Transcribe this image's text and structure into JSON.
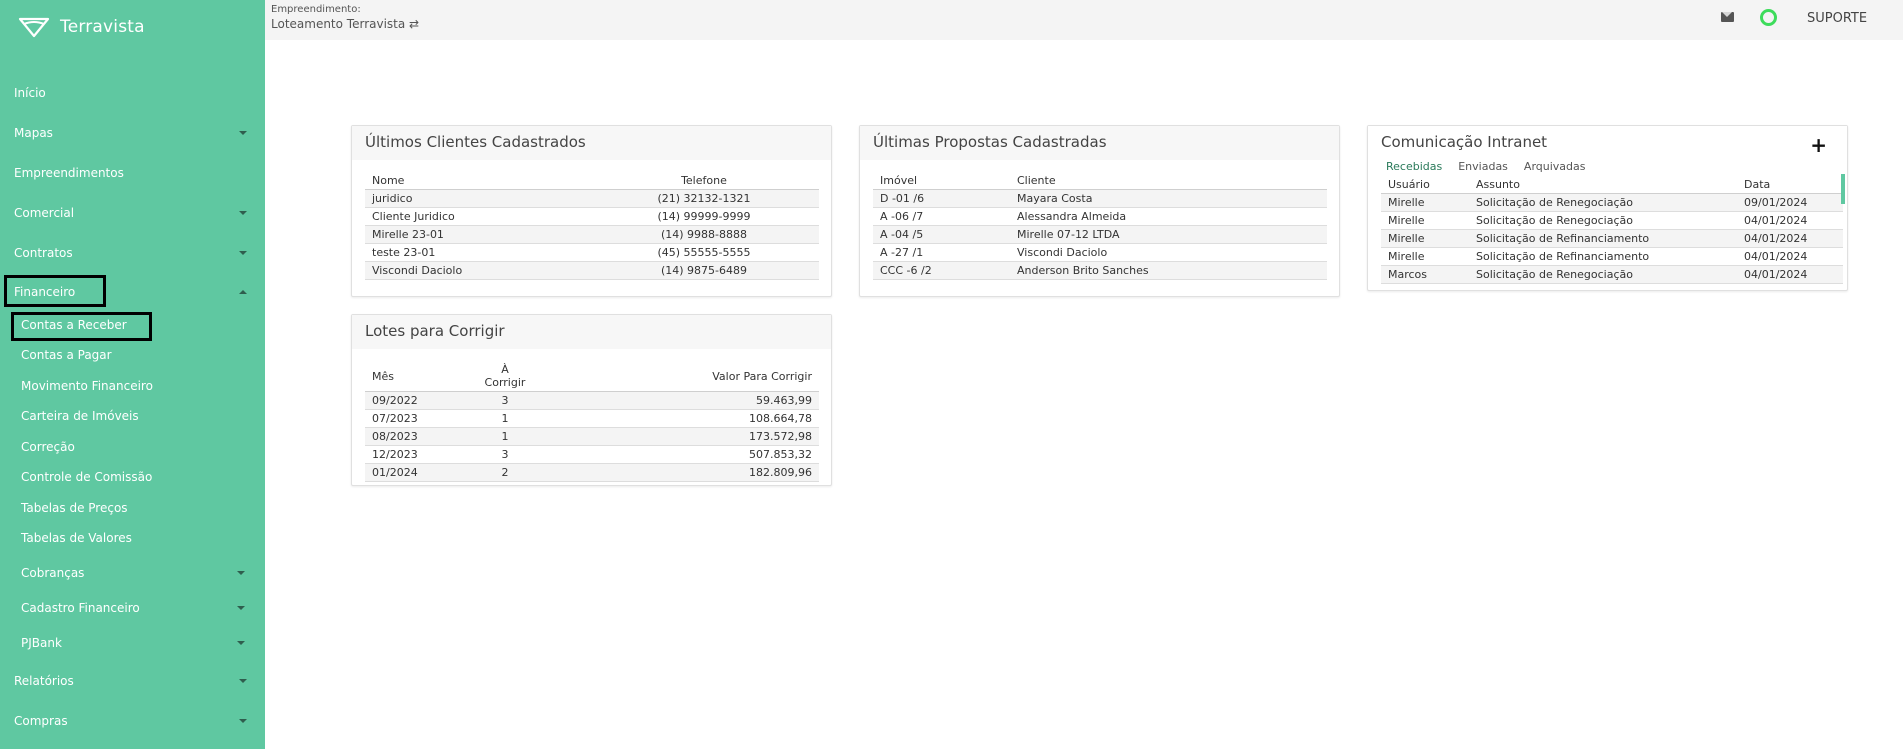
{
  "brand": {
    "name": "Terravista"
  },
  "sidebar": {
    "items": [
      {
        "label": "Início"
      },
      {
        "label": "Mapas"
      },
      {
        "label": "Empreendimentos"
      },
      {
        "label": "Comercial"
      },
      {
        "label": "Contratos"
      },
      {
        "label": "Financeiro"
      },
      {
        "label": "Relatórios"
      },
      {
        "label": "Compras"
      }
    ],
    "financeiro_sub": [
      {
        "label": "Contas a Receber"
      },
      {
        "label": "Contas a Pagar"
      },
      {
        "label": "Movimento Financeiro"
      },
      {
        "label": "Carteira de Imóveis"
      },
      {
        "label": "Correção"
      },
      {
        "label": "Controle de Comissão"
      },
      {
        "label": "Tabelas de Preços"
      },
      {
        "label": "Tabelas de Valores"
      },
      {
        "label": "Cobranças"
      },
      {
        "label": "Cadastro Financeiro"
      },
      {
        "label": "PJBank"
      }
    ]
  },
  "topbar": {
    "project_label": "Empreendimento:",
    "project_name": "Loteamento Terravista ⇄",
    "support": "SUPORTE",
    "status_color": "#3ddc5b"
  },
  "clients": {
    "title": "Últimos Clientes Cadastrados",
    "columns": [
      "Nome",
      "Telefone"
    ],
    "rows": [
      [
        "juridico",
        "(21) 32132-1321"
      ],
      [
        "Cliente Juridico",
        "(14) 99999-9999"
      ],
      [
        "Mirelle 23-01",
        "(14) 9988-8888"
      ],
      [
        "teste 23-01",
        "(45) 55555-5555"
      ],
      [
        "Viscondi Daciolo",
        "(14) 9875-6489"
      ]
    ]
  },
  "proposals": {
    "title": "Últimas Propostas Cadastradas",
    "columns": [
      "Imóvel",
      "Cliente"
    ],
    "rows": [
      [
        "D -01 /6",
        "Mayara Costa"
      ],
      [
        "A -06 /7",
        "Alessandra Almeida"
      ],
      [
        "A -04 /5",
        "Mirelle 07-12 LTDA"
      ],
      [
        "A -27 /1",
        "Viscondi Daciolo"
      ],
      [
        "CCC -6 /2",
        "Anderson Brito Sanches"
      ]
    ]
  },
  "intranet": {
    "title": "Comunicação Intranet",
    "add_label": "+",
    "tabs": [
      "Recebidas",
      "Enviadas",
      "Arquivadas"
    ],
    "columns": [
      "Usuário",
      "Assunto",
      "Data"
    ],
    "rows": [
      [
        "Mirelle",
        "Solicitação de Renegociação",
        "09/01/2024"
      ],
      [
        "Mirelle",
        "Solicitação de Renegociação",
        "04/01/2024"
      ],
      [
        "Mirelle",
        "Solicitação de Refinanciamento",
        "04/01/2024"
      ],
      [
        "Mirelle",
        "Solicitação de Refinanciamento",
        "04/01/2024"
      ],
      [
        "Marcos",
        "Solicitação de Renegociação",
        "04/01/2024"
      ]
    ]
  },
  "lots": {
    "title": "Lotes para Corrigir",
    "columns": [
      "Mês",
      "À Corrigir",
      "Valor Para Corrigir"
    ],
    "rows": [
      [
        "09/2022",
        "3",
        "59.463,99"
      ],
      [
        "07/2023",
        "1",
        "108.664,78"
      ],
      [
        "08/2023",
        "1",
        "173.572,98"
      ],
      [
        "12/2023",
        "3",
        "507.853,32"
      ],
      [
        "01/2024",
        "2",
        "182.809,96"
      ]
    ]
  }
}
